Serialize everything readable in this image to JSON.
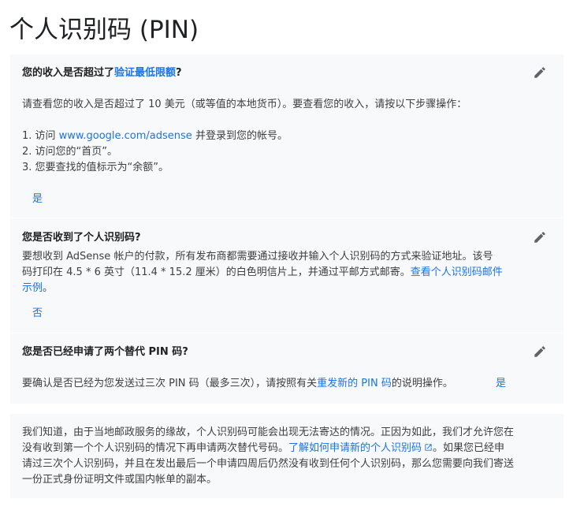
{
  "title": "个人识别码 (PIN)",
  "q1": {
    "prefix": "您的收入是否超过了",
    "link": "验证最低限额",
    "suffix": "?",
    "intro": "请查看您的收入是否超过了 10 美元（或等值的本地货币）。要查看您的收入，请按以下步骤操作：",
    "step1_prefix": "1. 访问 ",
    "step1_link": "www.google.com/adsense",
    "step1_suffix": " 并登录到您的帐号。",
    "step2": "2. 访问您的“首页”。",
    "step3": "3. 您要查找的值标示为“余额”。",
    "answer": "是"
  },
  "q2": {
    "title": "您是否收到了个人识别码?",
    "line1": "要想收到 AdSense 帐户的付款，所有发布商都需要通过接收并输入个人识别码的方式来验证地址。该号",
    "line2_text": "码打印在 4.5 * 6 英寸（11.4 * 15.2 厘米）的白色明信片上，并通过平邮方式邮寄。",
    "line2_link": "查看个人识别码邮件",
    "line3_link": "示例",
    "line3_suffix": "。",
    "answer": "否"
  },
  "q3": {
    "title": "您是否已经申请了两个替代 PIN 码?",
    "body_prefix": "要确认是否已经为您发送过三次 PIN 码（最多三次），请按照有关",
    "body_link": "重发新的 PIN 码",
    "body_suffix": "的说明操作。",
    "answer": "是"
  },
  "info": {
    "line1": "我们知道，由于当地邮政服务的缘故，个人识别码可能会出现无法寄达的情况。正因为如此，我们才允许您在",
    "line2_prefix": "没有收到第一个个人识别码的情况下再申请两次替代号码。",
    "line2_link": "了解如何申请新的个人识别码",
    "line2_suffix": "。如果您已经申",
    "line3": "请过三次个人识别码，并且在发出最后一个申请四周后仍然没有收到任何个人识别码，那么您需要向我们寄送",
    "line4": "一份正式身份证明文件或国内帐单的副本。"
  },
  "icons": {
    "edit": "pencil-icon",
    "external": "external-link-icon"
  },
  "colors": {
    "link": "#1a73e8",
    "panel_bg": "#f8f9fa",
    "text": "#3c4043"
  }
}
